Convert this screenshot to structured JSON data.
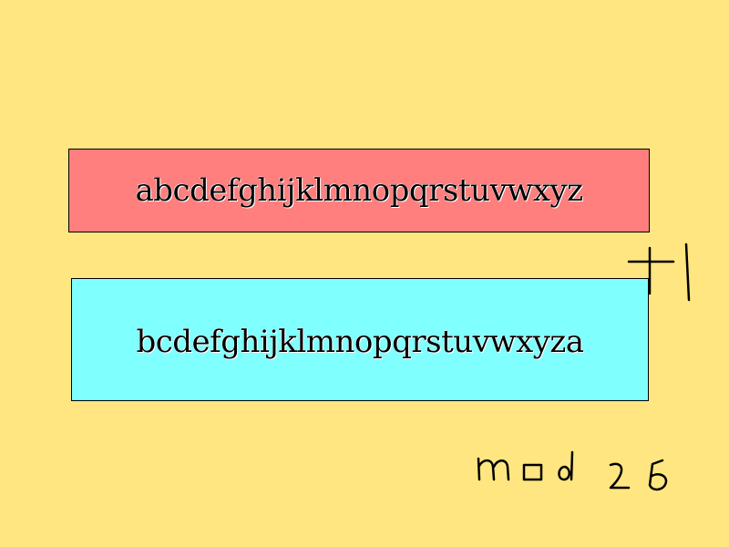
{
  "plaintext": {
    "text": "abcdefghijklmnopqrstuvwxyz",
    "color": "#ff7f7f"
  },
  "shifted": {
    "text": "bcdefghijklmnopqrstuvwxyza",
    "color": "#80ffff"
  },
  "annotations": {
    "shift": "+1",
    "modulus": "mod 26"
  },
  "background_color": "#ffe680"
}
